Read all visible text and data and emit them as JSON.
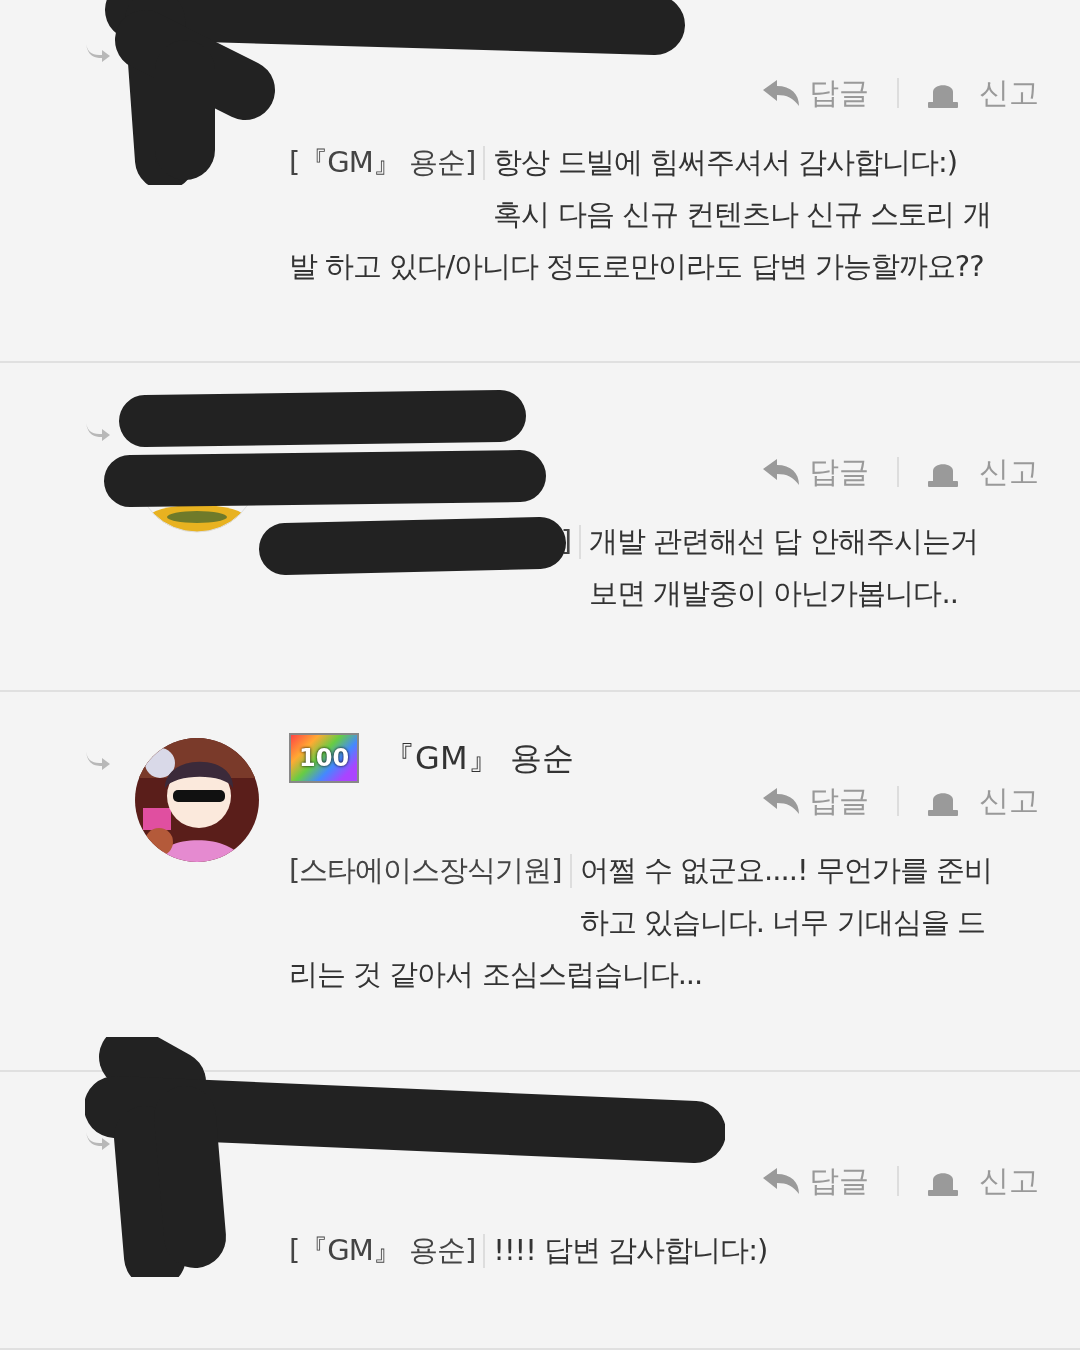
{
  "comments": [
    {
      "kind": "redacted",
      "tag": "[『GM』 용순]",
      "lines": [
        "항상 드빌에 힘써주셔서 감사합니다:)",
        "혹시 다음 신규 컨텐츠나 신규 스토리 개",
        "발 하고 있다/아니다 정도로만이라도 답변 가능할까요??"
      ],
      "actions": [
        "답글",
        "신고"
      ]
    },
    {
      "kind": "redacted",
      "tag": "]",
      "lines": [
        "개발 관련해선 답 안해주시는거",
        "보면 개발중이 아닌가봅니다.."
      ],
      "actions": [
        "답글",
        "신고"
      ]
    },
    {
      "kind": "visible",
      "badge": "100",
      "author": "『GM』 용순",
      "tag": "[스타에이스장식기원]",
      "lines": [
        "어쩔 수 없군요....! 무언가를 준비",
        "하고 있습니다. 너무 기대심을 드",
        "리는 것 같아서 조심스럽습니다..."
      ],
      "actions": [
        "답글",
        "신고"
      ]
    },
    {
      "kind": "redacted",
      "tag": "[『GM』 용순]",
      "lines": [
        "!!!! 답변 감사합니다:)"
      ],
      "actions": [
        "답글",
        "신고"
      ]
    }
  ]
}
